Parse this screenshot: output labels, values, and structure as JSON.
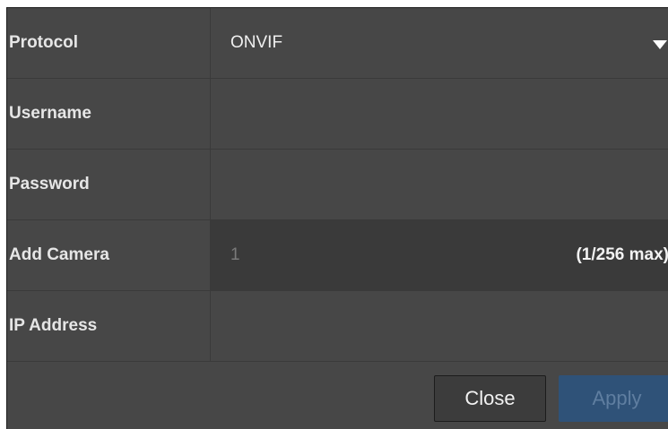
{
  "form": {
    "protocol": {
      "label": "Protocol",
      "value": "ONVIF"
    },
    "username": {
      "label": "Username",
      "value": ""
    },
    "password": {
      "label": "Password",
      "value": ""
    },
    "add_camera": {
      "label": "Add Camera",
      "value": "1",
      "max_note": "(1/256 max)"
    },
    "ip_address": {
      "label": "IP Address",
      "value": ""
    }
  },
  "buttons": {
    "close_label": "Close",
    "apply_label": "Apply"
  },
  "colors": {
    "panel_background": "#474747",
    "dark_field_background": "#3a3a3a",
    "apply_button": "#2f5278"
  },
  "icons": {
    "dropdown": "caret-down-icon"
  }
}
